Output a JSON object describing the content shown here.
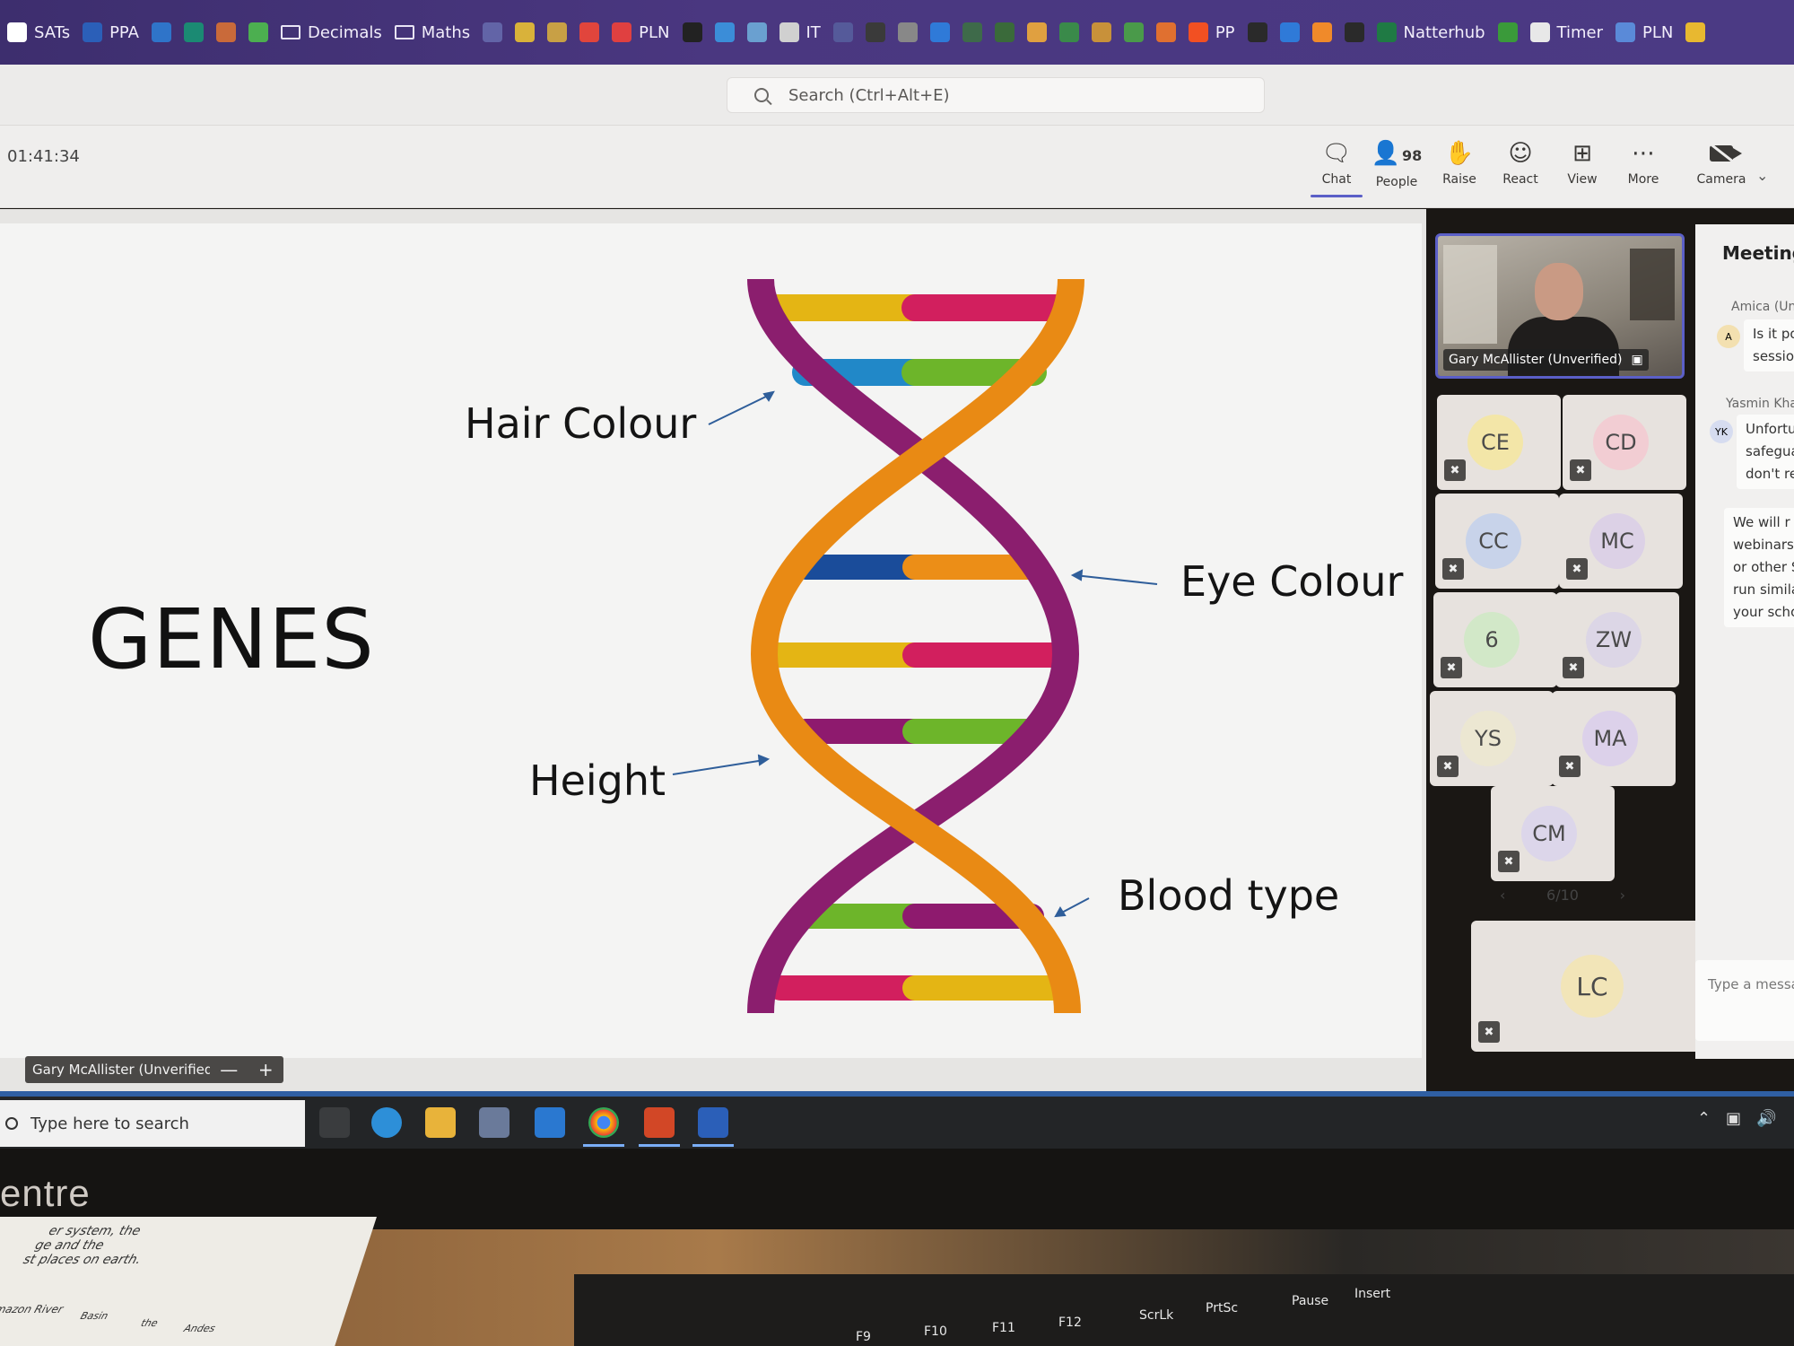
{
  "bookmarks": [
    {
      "label": "SATs",
      "icon": "dot-icon",
      "color": "#ffffff"
    },
    {
      "label": "PPA",
      "icon": "word-icon",
      "color": "#2b5fb8"
    },
    {
      "label": "",
      "icon": "outlook-icon",
      "color": "#2f74c9"
    },
    {
      "label": "",
      "icon": "sway-icon",
      "color": "#1b8a73"
    },
    {
      "label": "",
      "icon": "image-icon",
      "color": "#c96a3a"
    },
    {
      "label": "",
      "icon": "color-icon",
      "color": "#4caf50"
    },
    {
      "label": "Decimals",
      "icon": "folder-icon",
      "color": ""
    },
    {
      "label": "Maths",
      "icon": "folder-icon",
      "color": ""
    },
    {
      "label": "",
      "icon": "teams-icon",
      "color": "#6264a7"
    },
    {
      "label": "",
      "icon": "bee-icon",
      "color": "#d9b23a"
    },
    {
      "label": "",
      "icon": "chart-icon",
      "color": "#c8a045"
    },
    {
      "label": "",
      "icon": "tb-icon",
      "color": "#e1453c"
    },
    {
      "label": "PLN",
      "icon": "pln-icon",
      "color": "#e04040"
    },
    {
      "label": "",
      "icon": "r-icon",
      "color": "#222222"
    },
    {
      "label": "",
      "icon": "cloud-icon",
      "color": "#3b8dd8"
    },
    {
      "label": "",
      "icon": "robot-icon",
      "color": "#6aa0d0"
    },
    {
      "label": "IT",
      "icon": "it-icon",
      "color": "#d0d0d0"
    },
    {
      "label": "",
      "icon": "globe-icon",
      "color": "#555a9a"
    },
    {
      "label": "",
      "icon": "web-icon",
      "color": "#3a3a3a"
    },
    {
      "label": "",
      "icon": "flower-icon",
      "color": "#888888"
    },
    {
      "label": "",
      "icon": "p-icon",
      "color": "#2f7ad8"
    },
    {
      "label": "",
      "icon": "bolt-icon",
      "color": "#3e6a4a"
    },
    {
      "label": "",
      "icon": "hand-icon",
      "color": "#3a6a3a"
    },
    {
      "label": "",
      "icon": "egg-icon",
      "color": "#e0a040"
    },
    {
      "label": "",
      "icon": "ep-icon",
      "color": "#3a8a4a"
    },
    {
      "label": "",
      "icon": "house-icon",
      "color": "#c8913a"
    },
    {
      "label": "",
      "icon": "chat-bubble-icon",
      "color": "#4a9a4a"
    },
    {
      "label": "",
      "icon": "swirl-icon",
      "color": "#e07030"
    },
    {
      "label": "PP",
      "icon": "microsoft-icon",
      "color": "#f25022"
    },
    {
      "label": "",
      "icon": "k-icon",
      "color": "#2a2a2a"
    },
    {
      "label": "",
      "icon": "c-icon",
      "color": "#2f7ad8"
    },
    {
      "label": "",
      "icon": "orange-icon",
      "color": "#f08a2a"
    },
    {
      "label": "",
      "icon": "r2-icon",
      "color": "#2a2a2a"
    },
    {
      "label": "Natterhub",
      "icon": "excel-icon",
      "color": "#1f7a44"
    },
    {
      "label": "",
      "icon": "green-icon",
      "color": "#3a9a3a"
    },
    {
      "label": "Timer",
      "icon": "timer-icon",
      "color": "#e8e8e8"
    },
    {
      "label": "PLN",
      "icon": "pln2-icon",
      "color": "#5a8ad8"
    },
    {
      "label": "",
      "icon": "star-icon",
      "color": "#e8b830"
    }
  ],
  "search": {
    "placeholder": "Search (Ctrl+Alt+E)"
  },
  "meeting": {
    "elapsed": "01:41:34",
    "controls": {
      "chat": "Chat",
      "people": "People",
      "people_count": "98",
      "raise": "Raise",
      "react": "React",
      "view": "View",
      "more": "More",
      "camera": "Camera"
    }
  },
  "slide": {
    "title": "GENES",
    "labels": {
      "hair": "Hair Colour",
      "eye": "Eye Colour",
      "height": "Height",
      "blood": "Blood type"
    }
  },
  "presenter": {
    "name": "Gary McAllister (Unverified)",
    "zoom_minus": "—",
    "zoom_plus": "+"
  },
  "video": {
    "name": "Gary McAllister (Unverified)"
  },
  "participants": [
    {
      "initials": "CE",
      "color": "#f3e6a8"
    },
    {
      "initials": "CD",
      "color": "#f2cdd3"
    },
    {
      "initials": "CC",
      "color": "#c8d3ea"
    },
    {
      "initials": "MC",
      "color": "#dcd1e6"
    },
    {
      "initials": "6",
      "color": "#d2e8c8"
    },
    {
      "initials": "ZW",
      "color": "#dcd6e6"
    },
    {
      "initials": "YS",
      "color": "#ece7d2"
    },
    {
      "initials": "MA",
      "color": "#dcd1ea"
    },
    {
      "initials": "CM",
      "color": "#dcd6ea"
    },
    {
      "initials": "LC",
      "color": "#f2e5b8"
    }
  ],
  "pager": {
    "label": "6/10",
    "prev": "‹",
    "next": "›"
  },
  "chat": {
    "title": "Meeting",
    "messages": [
      {
        "author": "Amica (Unv",
        "avatar": "A",
        "avatar_color": "#f3e0b0",
        "lines": [
          "Is it pos",
          "session?"
        ]
      },
      {
        "author": "Yasmin Khan",
        "avatar": "YK",
        "avatar_color": "#d6dcf0",
        "lines": [
          "Unfortu",
          "safeguar",
          "don't rec"
        ]
      },
      {
        "author": "",
        "avatar": "",
        "avatar_color": "",
        "lines": [
          "We will r",
          "webinars",
          "or other S",
          "run simila",
          "your scho"
        ]
      }
    ],
    "input_placeholder": "Type a message"
  },
  "taskbar": {
    "search_placeholder": "Type here to search"
  },
  "hardware": {
    "brand": "entre",
    "paper_lines": [
      "ge and the",
      "st places on earth.",
      "er system, the",
      "Amazon River",
      "Basin",
      "the",
      "Andes"
    ],
    "keys": [
      "F9",
      "F10",
      "F11",
      "F12",
      "ScrLk",
      "PrtSc",
      "Pause",
      "Insert"
    ]
  }
}
